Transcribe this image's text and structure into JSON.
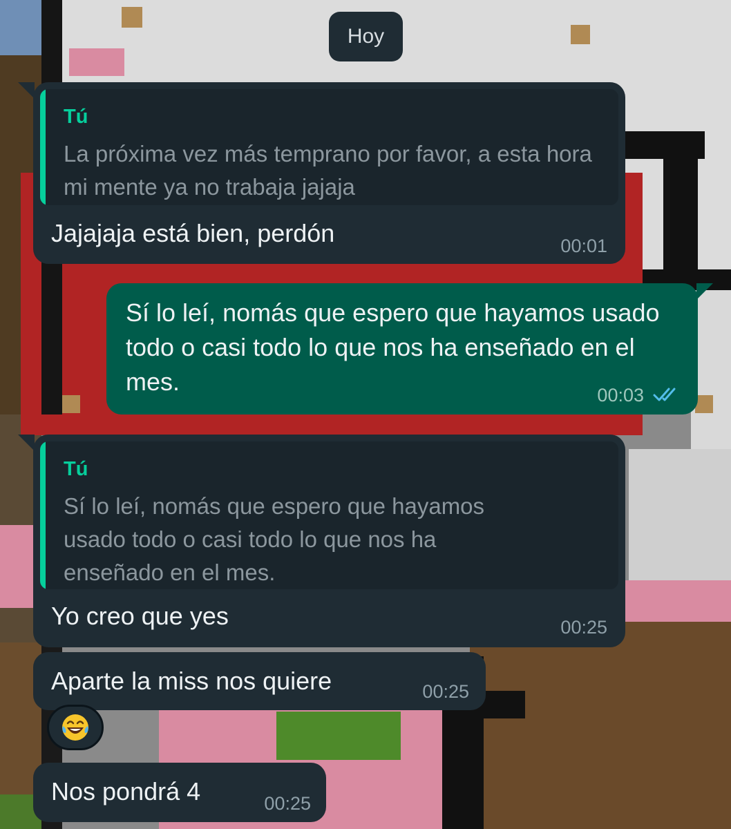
{
  "date_chip": "Hoy",
  "colors": {
    "incoming_bubble": "#1f2c34",
    "outgoing_bubble": "#005c4b",
    "quote_accent": "#06cf9c",
    "read_ticks": "#53bdeb"
  },
  "messages": [
    {
      "direction": "incoming",
      "quote": {
        "author": "Tú",
        "text": "La próxima vez más temprano por favor, a esta hora mi mente ya no trabaja jajaja"
      },
      "text": "Jajajaja está bien, perdón",
      "time": "00:01"
    },
    {
      "direction": "outgoing",
      "text": "Sí lo leí, nomás que espero que hayamos usado todo o casi todo lo que nos ha enseñado en el mes.",
      "time": "00:03",
      "status_icon": "double-check-read-icon"
    },
    {
      "direction": "incoming",
      "quote": {
        "author": "Tú",
        "text": "Sí lo leí, nomás que espero que hayamos usado todo o casi todo lo que nos ha enseñado en el mes."
      },
      "text": "Yo creo que yes",
      "time": "00:25"
    },
    {
      "direction": "incoming",
      "text": "Aparte la miss nos quiere",
      "time": "00:25",
      "reaction_icon": "laughing-tears-emoji-icon"
    },
    {
      "direction": "incoming",
      "text": "Nos pondrá 4",
      "time": "00:25"
    }
  ]
}
